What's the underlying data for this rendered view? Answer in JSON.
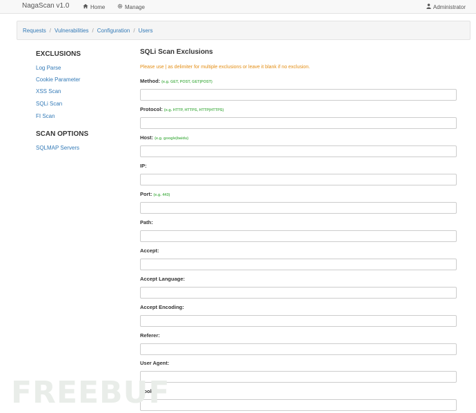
{
  "navbar": {
    "brand": "NagaScan v1.0",
    "home": {
      "icon": "home-icon",
      "label": "Home"
    },
    "manage": {
      "icon": "gear-icon",
      "label": "Manage"
    },
    "user": {
      "icon": "user-icon",
      "label": "Administrator"
    }
  },
  "breadcrumb": [
    "Requests",
    "Vulnerabilities",
    "Configuration",
    "Users"
  ],
  "sidebar": {
    "exclusions_heading": "EXCLUSIONS",
    "exclusions": [
      "Log Parse",
      "Cookie Parameter",
      "XSS Scan",
      "SQLi Scan",
      "FI Scan"
    ],
    "scan_options_heading": "SCAN OPTIONS",
    "scan_options": [
      "SQLMAP Servers"
    ]
  },
  "main": {
    "title": "SQLi Scan Exclusions",
    "hint": "Please use | as delimiter for multiple exclusions or leave it blank if no exclusion.",
    "fields": [
      {
        "label": "Method:",
        "example": "(e.g. GET, POST, GET|POST)",
        "value": ""
      },
      {
        "label": "Protocol:",
        "example": "(e.g. HTTP, HTTPS, HTTP|HTTPS)",
        "value": ""
      },
      {
        "label": "Host:",
        "example": "(e.g. google|baidu)",
        "value": ""
      },
      {
        "label": "IP:",
        "example": "",
        "value": ""
      },
      {
        "label": "Port:",
        "example": "(e.g. 443)",
        "value": ""
      },
      {
        "label": "Path:",
        "example": "",
        "value": ""
      },
      {
        "label": "Accept:",
        "example": "",
        "value": ""
      },
      {
        "label": "Accept Language:",
        "example": "",
        "value": ""
      },
      {
        "label": "Accept Encoding:",
        "example": "",
        "value": ""
      },
      {
        "label": "Referer:",
        "example": "",
        "value": ""
      },
      {
        "label": "User Agent:",
        "example": "",
        "value": ""
      },
      {
        "label": "Cookie:",
        "example": "",
        "value": ""
      }
    ]
  },
  "watermark": "FREEBUF",
  "colors": {
    "link": "#337ab7",
    "hint": "#e38d13",
    "example": "#5cb85c"
  }
}
